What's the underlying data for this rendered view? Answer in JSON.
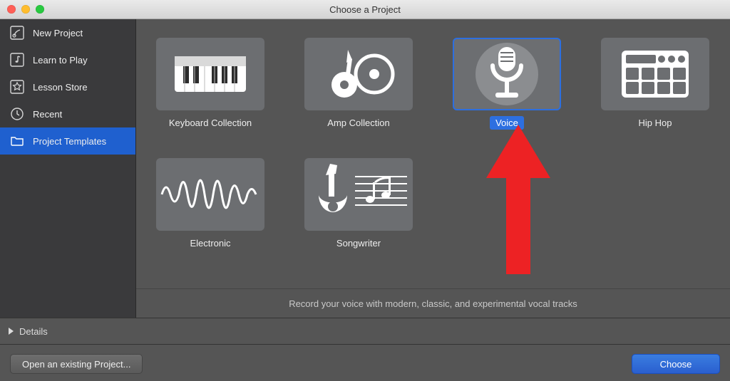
{
  "window": {
    "title": "Choose a Project"
  },
  "sidebar": {
    "items": [
      {
        "label": "New Project",
        "icon": "guitar-icon",
        "selected": false
      },
      {
        "label": "Learn to Play",
        "icon": "note-icon",
        "selected": false
      },
      {
        "label": "Lesson Store",
        "icon": "star-icon",
        "selected": false
      },
      {
        "label": "Recent",
        "icon": "clock-icon",
        "selected": false
      },
      {
        "label": "Project Templates",
        "icon": "folder-icon",
        "selected": true
      }
    ]
  },
  "templates": [
    {
      "label": "Keyboard Collection",
      "icon": "keyboard-icon",
      "selected": false
    },
    {
      "label": "Amp Collection",
      "icon": "amp-icon",
      "selected": false
    },
    {
      "label": "Voice",
      "icon": "microphone-icon",
      "selected": true
    },
    {
      "label": "Hip Hop",
      "icon": "drum-pad-icon",
      "selected": false
    },
    {
      "label": "Electronic",
      "icon": "waveform-icon",
      "selected": false
    },
    {
      "label": "Songwriter",
      "icon": "songwriter-icon",
      "selected": false
    }
  ],
  "description": "Record your voice with modern, classic, and experimental vocal tracks",
  "details": {
    "label": "Details"
  },
  "footer": {
    "open_label": "Open an existing Project...",
    "choose_label": "Choose"
  },
  "annotation": {
    "arrow_color": "#ed2224"
  }
}
